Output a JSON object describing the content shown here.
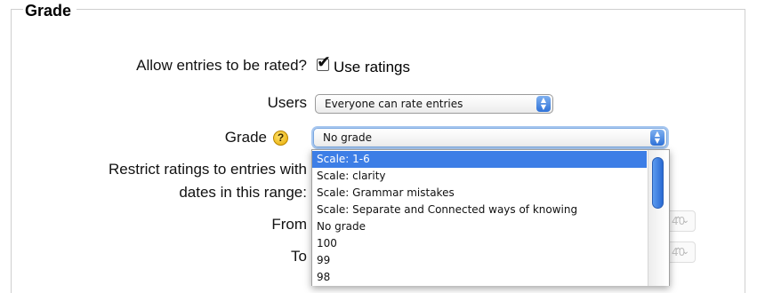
{
  "fieldset": {
    "legend": "Grade"
  },
  "ratings": {
    "label": "Allow entries to be rated?",
    "checkbox_label": "Use ratings",
    "checked": true
  },
  "users": {
    "label": "Users",
    "selected": "Everyone can rate entries"
  },
  "grade": {
    "label": "Grade",
    "help_icon": "question-mark-icon",
    "selected": "No grade",
    "options": [
      "Scale: 1-6",
      "Scale: clarity",
      "Scale: Grammar mistakes",
      "Scale: Separate and Connected ways of knowing",
      "No grade",
      "100",
      "99",
      "98"
    ],
    "highlighted_index": 0
  },
  "restrict": {
    "label_line1": "Restrict ratings to entries with",
    "label_line2": "dates in this range:"
  },
  "from": {
    "label": "From",
    "partial_value": "40"
  },
  "to": {
    "label": "To",
    "partial_value": "40"
  },
  "colors": {
    "accent": "#3d7ee6",
    "focus_ring": "#a8c8f0",
    "help_icon": "#f2c200"
  }
}
